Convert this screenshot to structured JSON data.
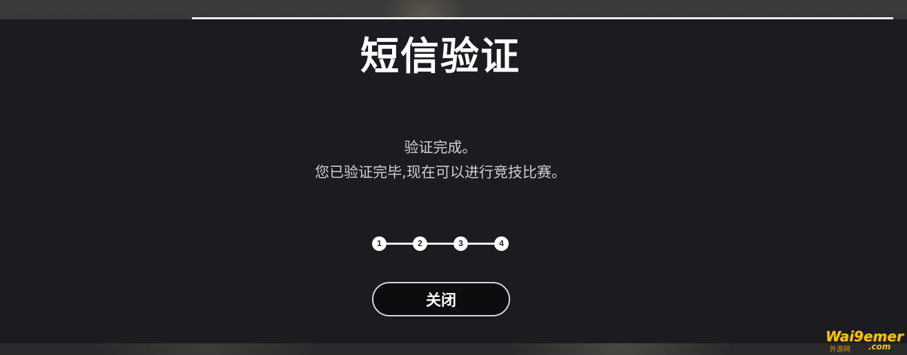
{
  "dialog": {
    "title": "短信验证",
    "message_line1": "验证完成。",
    "message_line2": "您已验证完毕,现在可以进行竞技比赛。",
    "steps": [
      "1",
      "2",
      "3",
      "4"
    ],
    "close_label": "关闭"
  },
  "watermark": {
    "brand": "Wai9emer",
    "sub": "外游网",
    "domain": ".com"
  },
  "colors": {
    "dialog_bg": "#1c1b20",
    "text_primary": "#ffffff",
    "text_secondary": "#cfcfd1",
    "button_bg": "#0d0d0f",
    "watermark": "#f5c21b"
  }
}
